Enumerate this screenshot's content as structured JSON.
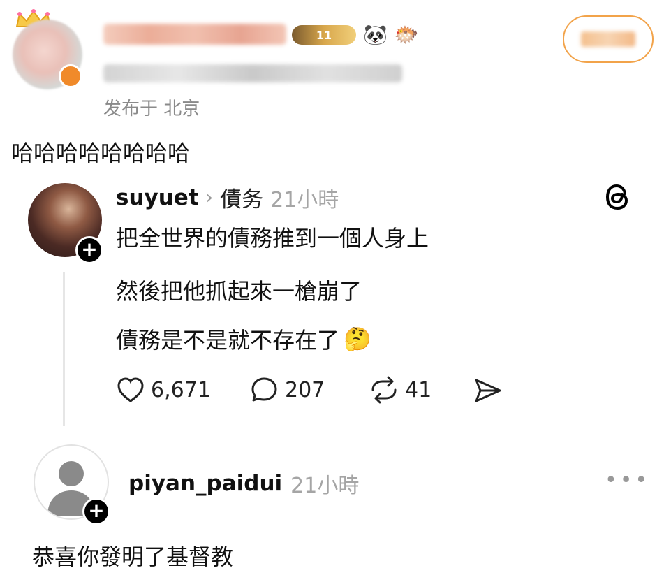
{
  "header": {
    "level_badge": "11",
    "location": "发布于 北京"
  },
  "post": {
    "text": "哈哈哈哈哈哈哈哈"
  },
  "threads_post": {
    "username": "suyuet",
    "topic": "債务",
    "time": "21小時",
    "lines": [
      "把全世界的債務推到一個人身上",
      "然後把他抓起來一槍崩了",
      "債務是不是就不存在了"
    ],
    "likes": "6,671",
    "comments": "207",
    "reposts": "41"
  },
  "reply": {
    "username": "piyan_paidui",
    "time": "21小時",
    "text": "恭喜你發明了基督教"
  }
}
